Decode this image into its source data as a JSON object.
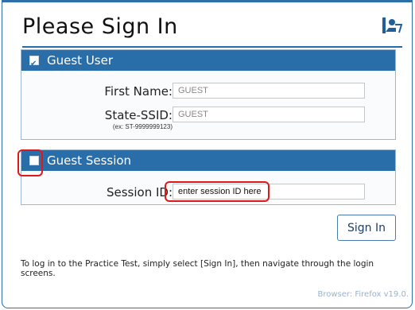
{
  "header": {
    "title": "Please Sign In",
    "logo_icon": "reading-person-logo-icon"
  },
  "guest_user": {
    "label": "Guest User",
    "checked": true,
    "first_name": {
      "label": "First Name:",
      "value": "GUEST"
    },
    "ssid": {
      "label": "State-SSID:",
      "value": "GUEST",
      "hint": "(ex: ST-9999999123)"
    }
  },
  "guest_session": {
    "label": "Guest Session",
    "checked": false,
    "session_id": {
      "label": "Session ID:",
      "placeholder": "enter session ID here"
    }
  },
  "signin_button": "Sign In",
  "instructions": "To log in to the Practice Test, simply select [Sign In], then navigate through the login screens.",
  "browser_info": "Browser: Firefox v19.0.",
  "colors": {
    "accent": "#2a6ea9",
    "highlight": "#e01818"
  }
}
